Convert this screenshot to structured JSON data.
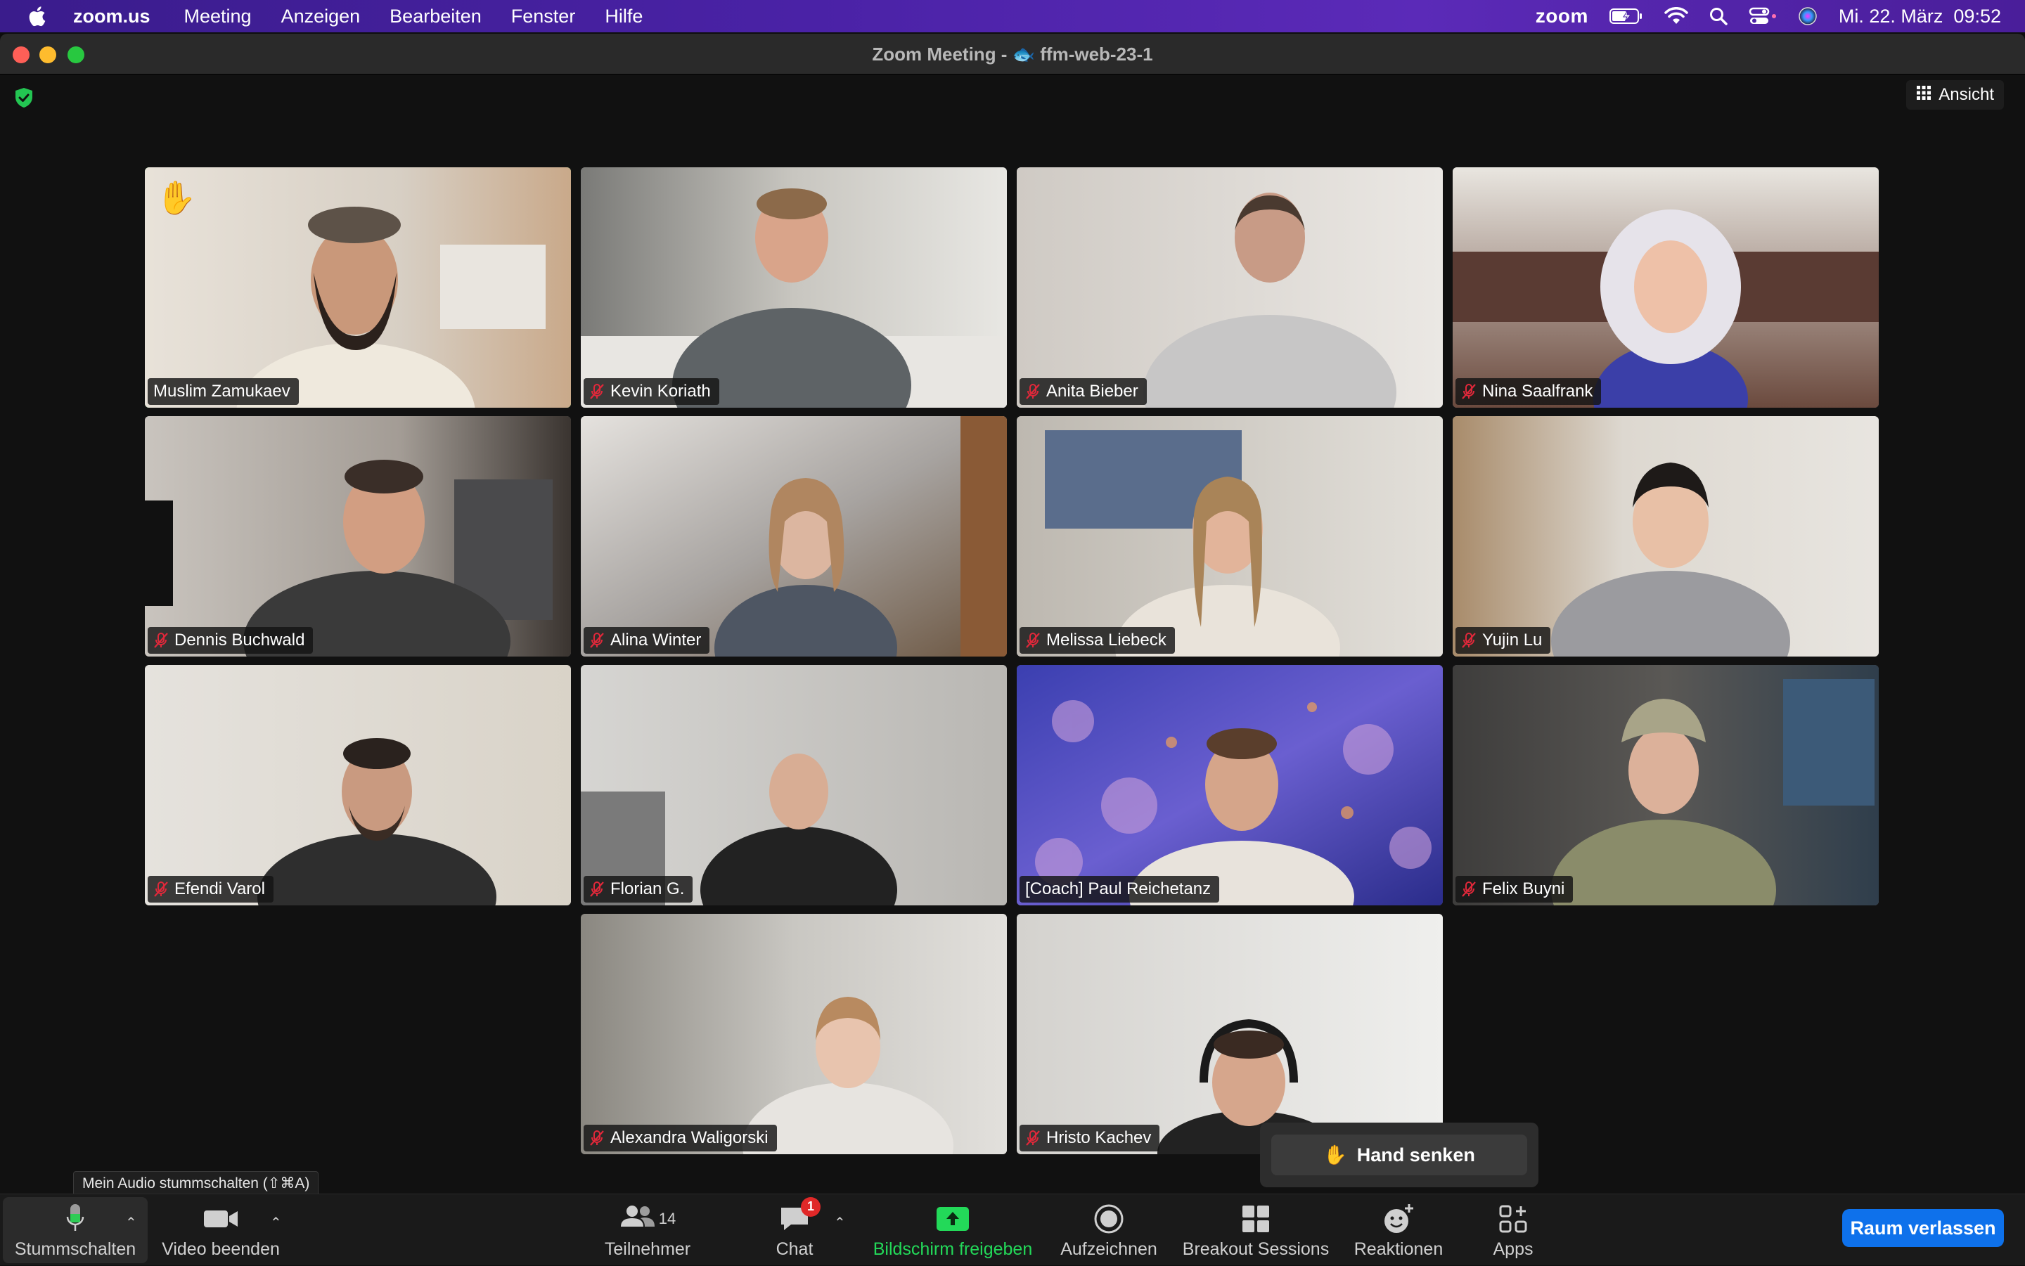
{
  "menubar": {
    "app_name": "zoom.us",
    "items": [
      "Meeting",
      "Anzeigen",
      "Bearbeiten",
      "Fenster",
      "Hilfe"
    ],
    "zoom_label": "zoom",
    "datetime": "Mi. 22. März  09:52"
  },
  "window": {
    "title": "Zoom Meeting - 🐟 ffm-web-23-1",
    "view_label": "Ansicht"
  },
  "participants": [
    {
      "name": "Muslim Zamukaev",
      "muted": false,
      "active": true,
      "hand_raised": true
    },
    {
      "name": "Kevin Koriath",
      "muted": true
    },
    {
      "name": "Anita Bieber",
      "muted": true
    },
    {
      "name": "Nina Saalfrank",
      "muted": true
    },
    {
      "name": "Dennis Buchwald",
      "muted": true
    },
    {
      "name": "Alina Winter",
      "muted": true
    },
    {
      "name": "Melissa Liebeck",
      "muted": true
    },
    {
      "name": "Yujin Lu",
      "muted": true
    },
    {
      "name": "Efendi Varol",
      "muted": true
    },
    {
      "name": "Florian G.",
      "muted": true
    },
    {
      "name": "[Coach] Paul Reichetanz",
      "muted": false
    },
    {
      "name": "Felix Buyni",
      "muted": true
    },
    {
      "name": "Alexandra Waligorski",
      "muted": true
    },
    {
      "name": "Hristo Kachev",
      "muted": true
    }
  ],
  "popup": {
    "hand_lower": "Hand senken",
    "hand_emoji": "✋"
  },
  "tooltip": "Mein Audio stummschalten (⇧⌘A)",
  "toolbar": {
    "mute": "Stummschalten",
    "video": "Video beenden",
    "participants": "Teilnehmer",
    "participants_count": "14",
    "chat": "Chat",
    "chat_badge": "1",
    "share": "Bildschirm freigeben",
    "record": "Aufzeichnen",
    "breakout": "Breakout Sessions",
    "reactions": "Reaktionen",
    "apps": "Apps",
    "leave": "Raum verlassen"
  },
  "colors": {
    "active_speaker": "#3fd34f",
    "share_green": "#23d959",
    "leave_blue": "#0e71eb",
    "muted_red": "#e0283a"
  }
}
